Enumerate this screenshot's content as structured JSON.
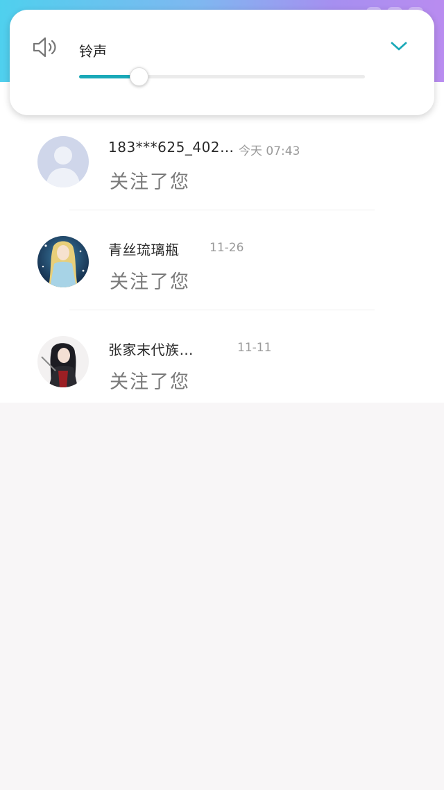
{
  "volume_panel": {
    "label": "铃声",
    "level": 0.21,
    "accent_color": "#1aa9b8",
    "icons": {
      "speaker": "speaker-icon",
      "collapse": "chevron-down-icon"
    }
  },
  "notifications": [
    {
      "name": "183***625_402…",
      "time": "今天 07:43",
      "action": "关注了您",
      "avatar": "default-avatar"
    },
    {
      "name": "青丝琉璃瓶",
      "time": "11-26",
      "action": "关注了您",
      "avatar": "anime-avatar-blonde"
    },
    {
      "name": "张家末代族…",
      "time": "11-11",
      "action": "关注了您",
      "avatar": "anime-avatar-dark"
    }
  ]
}
